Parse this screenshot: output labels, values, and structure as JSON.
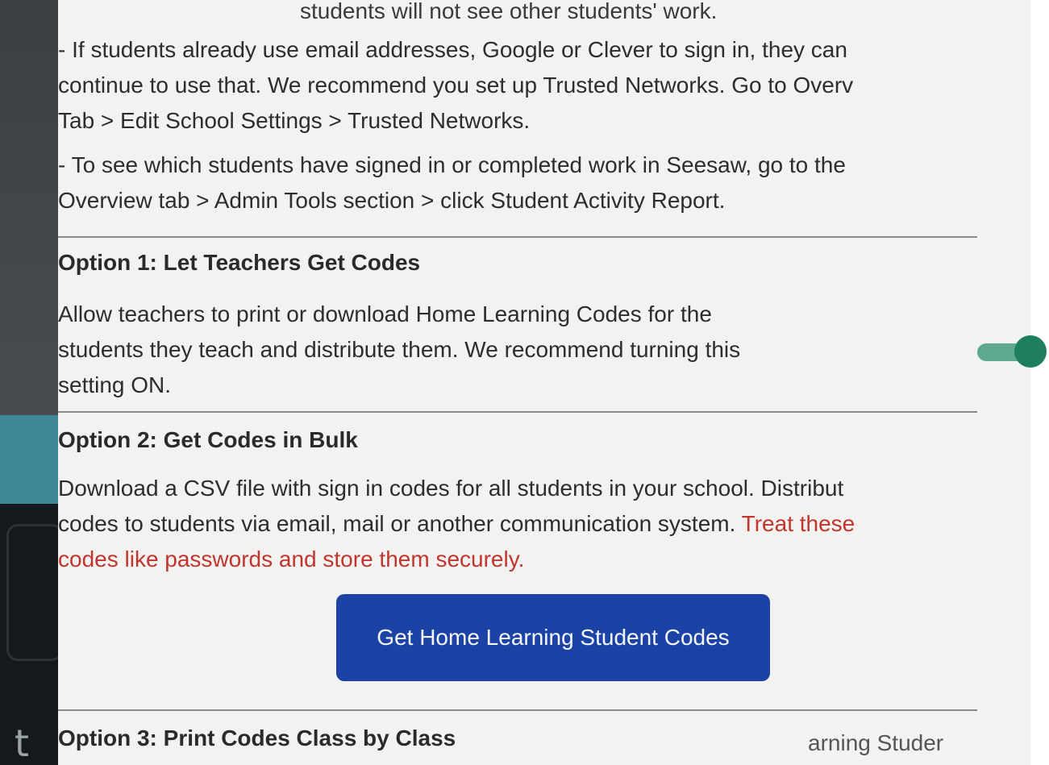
{
  "intro": {
    "top_fragment": "students will not see other students' work.",
    "bullet_1": [
      "- If students already use email addresses, Google or Clever to sign in, they can",
      "continue to use that. We recommend you set up Trusted Networks. Go to Overv",
      "Tab > Edit School Settings > Trusted Networks."
    ],
    "bullet_2": [
      "- To see which students have signed in or completed work in Seesaw, go to the",
      "Overview tab > Admin Tools section > click Student Activity Report."
    ]
  },
  "option1": {
    "title": "Option 1: Let Teachers Get Codes",
    "desc": [
      "Allow teachers to print or download Home Learning Codes for the",
      "students they teach and distribute them. We recommend turning this",
      "setting ON."
    ],
    "toggle_state": "on"
  },
  "option2": {
    "title": "Option 2: Get Codes in Bulk",
    "desc_line1": "Download a CSV file with sign in codes for all students in your school. Distribut",
    "desc_line2_plain": "codes to students via email, mail or another communication system. ",
    "desc_line2_warn": "Treat these",
    "desc_line3_warn": "codes like passwords and store them securely.",
    "button_label": "Get Home Learning Student Codes"
  },
  "option3": {
    "title": "Option 3: Print Codes Class by Class",
    "trailing_fragment": "arning Studer"
  },
  "colors": {
    "accent_button": "#1b43a6",
    "warning_text": "#c0352e",
    "toggle_on": "#1d7f60"
  }
}
